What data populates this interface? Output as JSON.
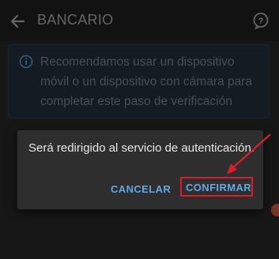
{
  "appbar": {
    "title": "BANCARIO",
    "back_icon": "arrow-left-icon",
    "help_icon": "help-bubble-icon"
  },
  "info_banner": {
    "icon": "info-icon",
    "text": "Recomendamos usar un dispositivo móvil o un dispositivo con cámara para completar este paso de verificación"
  },
  "dialog": {
    "message": "Será redirigido al servicio de autenticación.",
    "cancel_label": "CANCELAR",
    "confirm_label": "CONFIRMAR"
  },
  "colors": {
    "background": "#242424",
    "accent": "#64a7e6",
    "highlight": "#d81e2b"
  }
}
